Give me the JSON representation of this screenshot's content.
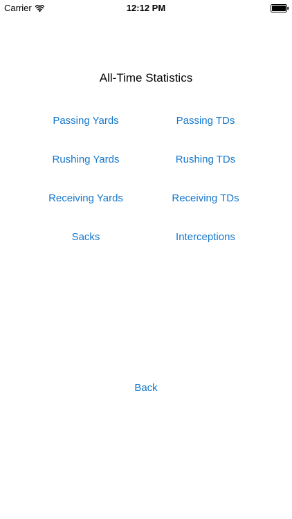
{
  "status_bar": {
    "carrier": "Carrier",
    "time": "12:12 PM",
    "icons": [
      "wifi-icon",
      "battery-icon"
    ]
  },
  "screen": {
    "title": "All-Time Statistics"
  },
  "stats_menu": {
    "items": [
      {
        "label": "Passing Yards"
      },
      {
        "label": "Passing TDs"
      },
      {
        "label": "Rushing Yards"
      },
      {
        "label": "Rushing TDs"
      },
      {
        "label": "Receiving Yards"
      },
      {
        "label": "Receiving TDs"
      },
      {
        "label": "Sacks"
      },
      {
        "label": "Interceptions"
      }
    ]
  },
  "navigation": {
    "back_label": "Back"
  },
  "colors": {
    "tint": "#1577cc",
    "background": "#ffffff",
    "text": "#000000"
  }
}
